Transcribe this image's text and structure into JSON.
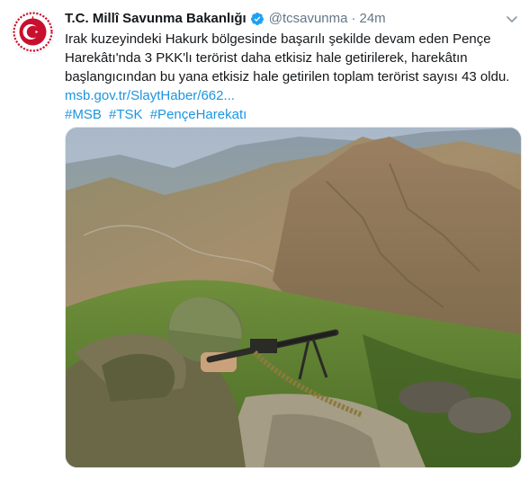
{
  "tweet": {
    "display_name": "T.C. Millî Savunma Bakanlığı",
    "verified_icon": "verified-badge-icon",
    "handle": "@tcsavunma",
    "separator": "·",
    "time": "24m",
    "text_lines": [
      "Irak kuzeyindeki Hakurk bölgesinde başarılı şekilde devam eden Pençe",
      "Harekâtı'nda 3 PKK'lı terörist daha etkisiz hale getirilerek, harekâtın",
      "başlangıcından bu yana etkisiz hale getirilen toplam terörist sayısı 43 oldu."
    ],
    "link": "msb.gov.tr/SlaytHaber/662...",
    "hashtags": [
      "#MSB",
      "#TSK",
      "#PençeHarekatı"
    ],
    "media_alt": "photo",
    "colors": {
      "link": "#1b95e0",
      "muted": "#657786",
      "text": "#14171a",
      "avatar_red": "#c8102e"
    }
  }
}
